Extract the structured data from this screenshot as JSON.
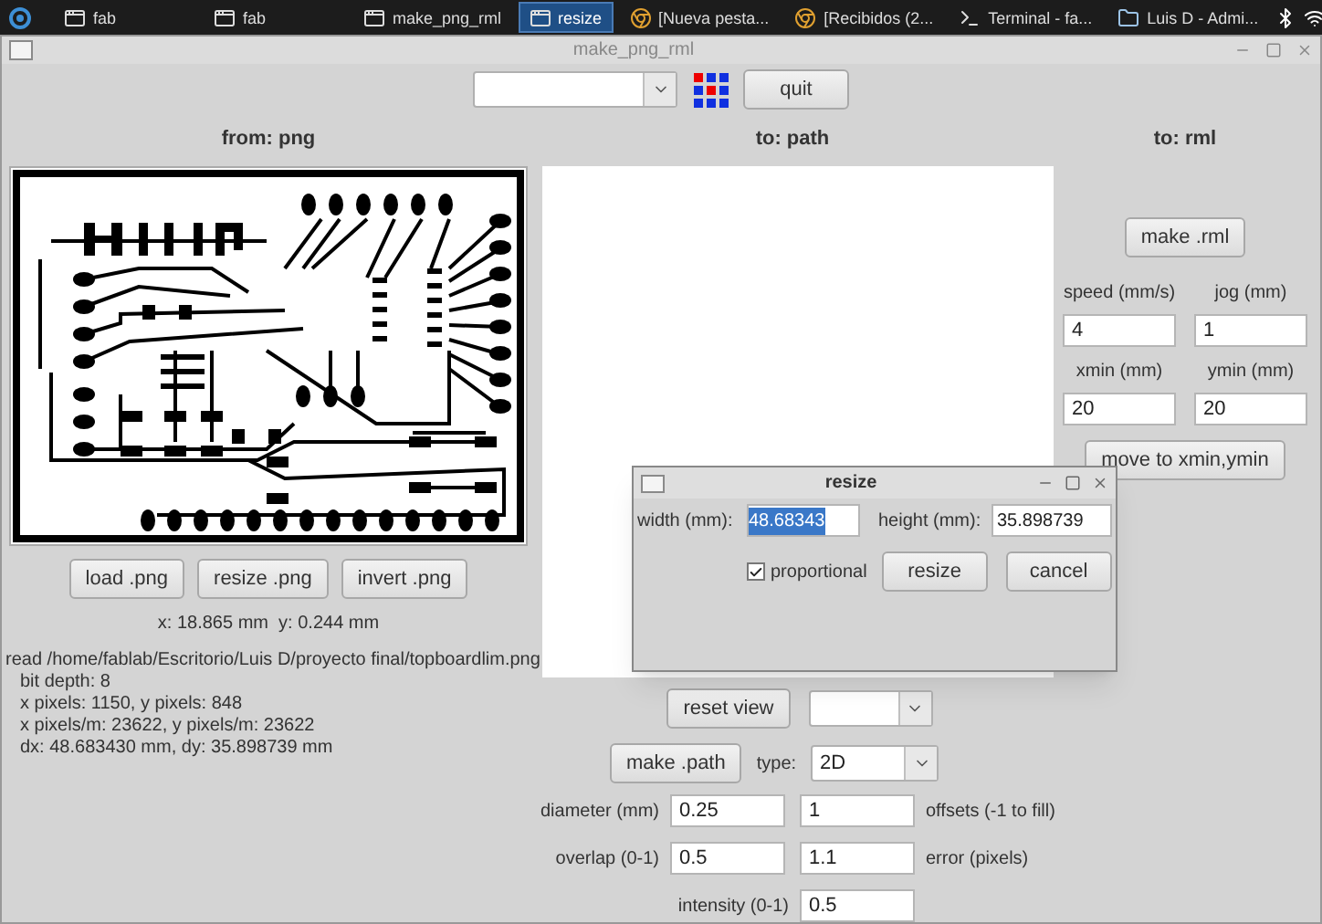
{
  "taskbar": {
    "items": [
      {
        "label": "fab",
        "kind": "window",
        "selected": false
      },
      {
        "label": "fab",
        "kind": "window",
        "selected": false
      },
      {
        "label": "make_png_rml",
        "kind": "window",
        "selected": false
      },
      {
        "label": "resize",
        "kind": "window",
        "selected": true
      },
      {
        "label": "[Nueva pesta...",
        "kind": "browser",
        "selected": false
      },
      {
        "label": "[Recibidos (2...",
        "kind": "browser",
        "selected": false
      },
      {
        "label": "Terminal - fa...",
        "kind": "terminal",
        "selected": false
      },
      {
        "label": "Luis D - Admi...",
        "kind": "folder",
        "selected": false
      }
    ]
  },
  "window": {
    "title": "make_png_rml"
  },
  "toolbar": {
    "quit_button": "quit"
  },
  "from_png": {
    "heading": "from: png",
    "buttons": [
      "load .png",
      "resize .png",
      "invert .png"
    ],
    "cursor": "x: 18.865 mm  y: 0.244 mm",
    "info": [
      "read /home/fablab/Escritorio/Luis D/proyecto final/topboardlim.png",
      "bit depth: 8",
      "x pixels: 1150, y pixels: 848",
      "x pixels/m: 23622, y pixels/m: 23622",
      "dx: 48.683430 mm, dy: 35.898739 mm"
    ]
  },
  "to_path": {
    "heading": "to: path",
    "reset_button": "reset view",
    "make_button": "make .path",
    "type_label": "type:",
    "type_value": "2D",
    "rows": [
      {
        "label": "diameter (mm)",
        "value_1": "0.25",
        "value_2": "1",
        "note": "offsets (-1 to fill)"
      },
      {
        "label": "overlap (0-1)",
        "value_1": "0.5",
        "value_2": "1.1",
        "note": "error (pixels)"
      },
      {
        "label": "intensity (0-1)",
        "value_1": "0.5"
      }
    ]
  },
  "to_rml": {
    "heading": "to: rml",
    "make_button": "make .rml",
    "fields": [
      {
        "label": "speed (mm/s)",
        "value": "4"
      },
      {
        "label": "jog (mm)",
        "value": "1"
      },
      {
        "label": "xmin (mm)",
        "value": "20"
      },
      {
        "label": "ymin (mm)",
        "value": "20"
      }
    ],
    "move_button": "move to xmin,ymin"
  },
  "dialog": {
    "title": "resize",
    "width_label": "width (mm):",
    "width_value": "48.68343",
    "width_selected": true,
    "height_label": "height (mm):",
    "height_value": "35.898739",
    "proportional": {
      "label": "proportional",
      "checked": true
    },
    "buttons": [
      "resize",
      "cancel"
    ]
  }
}
